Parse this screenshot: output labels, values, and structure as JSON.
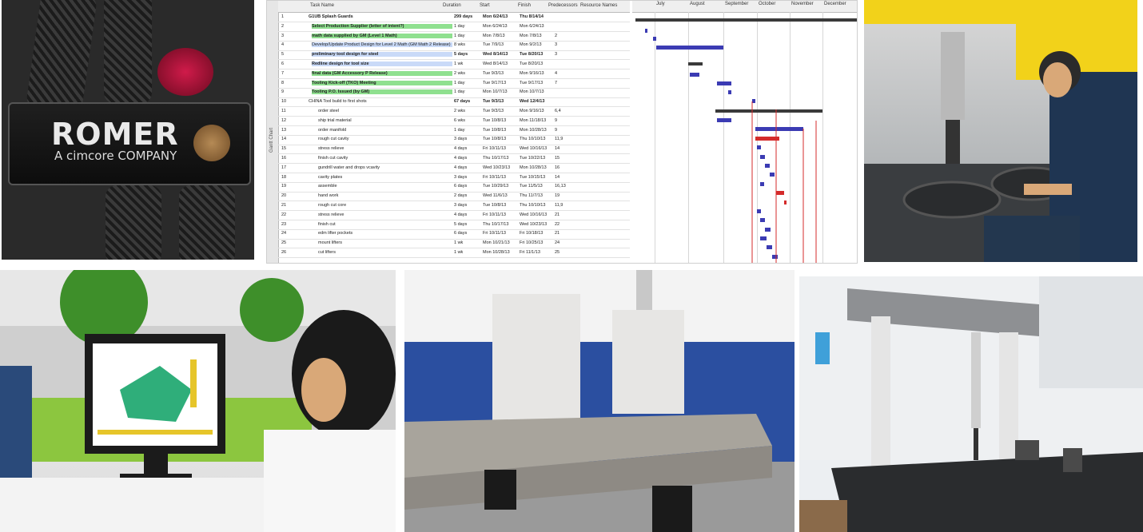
{
  "panel1": {
    "brand": "ROMER",
    "tagline": "A cimcore COMPANY"
  },
  "panel2": {
    "columns": [
      "Task Name",
      "Duration",
      "Start",
      "Finish",
      "Predecessors",
      "Resource Names"
    ],
    "months": [
      "July",
      "August",
      "September",
      "October",
      "November",
      "December"
    ],
    "side_label": "Gantt Chart",
    "rows": [
      {
        "id": "1",
        "name": "G1UB Splash Guards",
        "dur": "299 days",
        "start": "Mon 6/24/13",
        "finish": "Thu 8/14/14",
        "pred": ""
      },
      {
        "id": "2",
        "name": "Select Production Supplier (letter of intent?)",
        "dur": "1 day",
        "start": "Mon 6/24/13",
        "finish": "Mon 6/24/13",
        "pred": ""
      },
      {
        "id": "3",
        "name": "math data supplied by GM (Level 1 Math)",
        "dur": "1 day",
        "start": "Mon 7/8/13",
        "finish": "Mon 7/8/13",
        "pred": "2"
      },
      {
        "id": "4",
        "name": "Develop/Update Product Design for Level 2 Math (GM Math 2 Release)",
        "dur": "8 wks",
        "start": "Tue 7/9/13",
        "finish": "Mon 9/2/13",
        "pred": "3"
      },
      {
        "id": "5",
        "name": "preliminary tool design for steel",
        "dur": "5 days",
        "start": "Wed 8/14/13",
        "finish": "Tue 8/20/13",
        "pred": "3"
      },
      {
        "id": "6",
        "name": "Redline design for tool size",
        "dur": "1 wk",
        "start": "Wed 8/14/13",
        "finish": "Tue 8/20/13",
        "pred": ""
      },
      {
        "id": "7",
        "name": "final data (GM Accessory P Release)",
        "dur": "2 wks",
        "start": "Tue 9/3/13",
        "finish": "Mon 9/16/13",
        "pred": "4"
      },
      {
        "id": "8",
        "name": "Tooling Kick-off (TKO) Meeting",
        "dur": "1 day",
        "start": "Tue 9/17/13",
        "finish": "Tue 9/17/13",
        "pred": "7"
      },
      {
        "id": "9",
        "name": "Tooling P.O. Issued (by GM)",
        "dur": "1 day",
        "start": "Mon 10/7/13",
        "finish": "Mon 10/7/13",
        "pred": ""
      },
      {
        "id": "10",
        "name": "CHINA Tool build to first shots",
        "dur": "67 days",
        "start": "Tue 9/3/13",
        "finish": "Wed 12/4/13",
        "pred": ""
      },
      {
        "id": "11",
        "name": "order steel",
        "dur": "2 wks",
        "start": "Tue 9/3/13",
        "finish": "Mon 9/16/13",
        "pred": "6,4"
      },
      {
        "id": "12",
        "name": "ship trial material",
        "dur": "6 wks",
        "start": "Tue 10/8/13",
        "finish": "Mon 11/18/13",
        "pred": "9"
      },
      {
        "id": "13",
        "name": "order manifold",
        "dur": "1 day",
        "start": "Tue 10/8/13",
        "finish": "Mon 10/28/13",
        "pred": "9"
      },
      {
        "id": "14",
        "name": "rough cut cavity",
        "dur": "3 days",
        "start": "Tue 10/8/13",
        "finish": "Thu 10/10/13",
        "pred": "11,9"
      },
      {
        "id": "15",
        "name": "stress relieve",
        "dur": "4 days",
        "start": "Fri 10/11/13",
        "finish": "Wed 10/16/13",
        "pred": "14"
      },
      {
        "id": "16",
        "name": "finish cut cavity",
        "dur": "4 days",
        "start": "Thu 10/17/13",
        "finish": "Tue 10/22/13",
        "pred": "15"
      },
      {
        "id": "17",
        "name": "gundrill water and drops vcavity",
        "dur": "4 days",
        "start": "Wed 10/23/13",
        "finish": "Mon 10/28/13",
        "pred": "16"
      },
      {
        "id": "18",
        "name": "cavity plates",
        "dur": "3 days",
        "start": "Fri 10/11/13",
        "finish": "Tue 10/15/13",
        "pred": "14"
      },
      {
        "id": "19",
        "name": "assemble",
        "dur": "6 days",
        "start": "Tue 10/29/13",
        "finish": "Tue 11/5/13",
        "pred": "16,13"
      },
      {
        "id": "20",
        "name": "hand work",
        "dur": "2 days",
        "start": "Wed 11/6/13",
        "finish": "Thu 11/7/13",
        "pred": "19"
      },
      {
        "id": "21",
        "name": "rough cut core",
        "dur": "3 days",
        "start": "Tue 10/8/13",
        "finish": "Thu 10/10/13",
        "pred": "11,9"
      },
      {
        "id": "22",
        "name": "stress relieve",
        "dur": "4 days",
        "start": "Fri 10/11/13",
        "finish": "Wed 10/16/13",
        "pred": "21"
      },
      {
        "id": "23",
        "name": "finish cut",
        "dur": "5 days",
        "start": "Thu 10/17/13",
        "finish": "Wed 10/23/13",
        "pred": "22"
      },
      {
        "id": "24",
        "name": "edm lifter pockets",
        "dur": "6 days",
        "start": "Fri 10/11/13",
        "finish": "Fri 10/18/13",
        "pred": "21"
      },
      {
        "id": "25",
        "name": "mount lifters",
        "dur": "1 wk",
        "start": "Mon 10/21/13",
        "finish": "Fri 10/25/13",
        "pred": "24"
      },
      {
        "id": "26",
        "name": "cut lifters",
        "dur": "1 wk",
        "start": "Mon 10/28/13",
        "finish": "Fri 11/1/13",
        "pred": "25"
      }
    ]
  },
  "colors": {
    "summary_bar": "#3a3a3a",
    "task_bar": "#3b3bb3",
    "critical_bar": "#d42b2b",
    "highlight_green": "#8fe08f",
    "highlight_blue": "#c9daf8"
  }
}
